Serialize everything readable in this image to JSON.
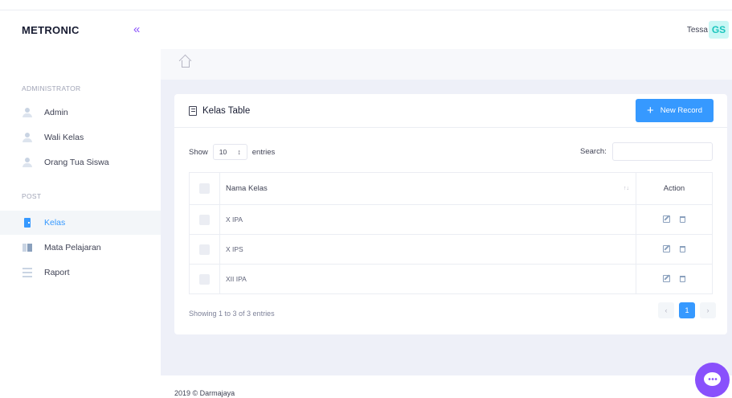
{
  "app": {
    "brand": "METRONIC"
  },
  "colors": {
    "primary": "#3699ff",
    "accent": "#8950fc",
    "avatar_bg": "#c9f7f5",
    "avatar_fg": "#1bc5bd"
  },
  "sidebar": {
    "sections": [
      {
        "title": "ADMINISTRATOR",
        "items": [
          {
            "label": "Admin",
            "icon": "user-icon"
          },
          {
            "label": "Wali Kelas",
            "icon": "user-icon"
          },
          {
            "label": "Orang Tua Siswa",
            "icon": "user-icon"
          }
        ]
      },
      {
        "title": "POST",
        "items": [
          {
            "label": "Kelas",
            "icon": "door-icon",
            "active": true
          },
          {
            "label": "Mata Pelajaran",
            "icon": "book-icon"
          },
          {
            "label": "Raport",
            "icon": "list-icon"
          }
        ]
      }
    ]
  },
  "header": {
    "user_name": "Tessa",
    "avatar_initials": "GS"
  },
  "card": {
    "title": "Kelas Table",
    "new_button": "New Record",
    "show_label": "Show",
    "page_length": "10",
    "entries_label": "entries",
    "search_label": "Search:",
    "search_value": "",
    "columns": {
      "name": "Nama Kelas",
      "action": "Action"
    },
    "rows": [
      {
        "name": "X IPA"
      },
      {
        "name": "X IPS"
      },
      {
        "name": "XII IPA"
      }
    ],
    "info": "Showing 1 to 3 of 3 entries",
    "pagination": {
      "prev": "‹",
      "current": "1",
      "next": "›"
    }
  },
  "footer": {
    "copyright": "2019 © Darmajaya"
  }
}
